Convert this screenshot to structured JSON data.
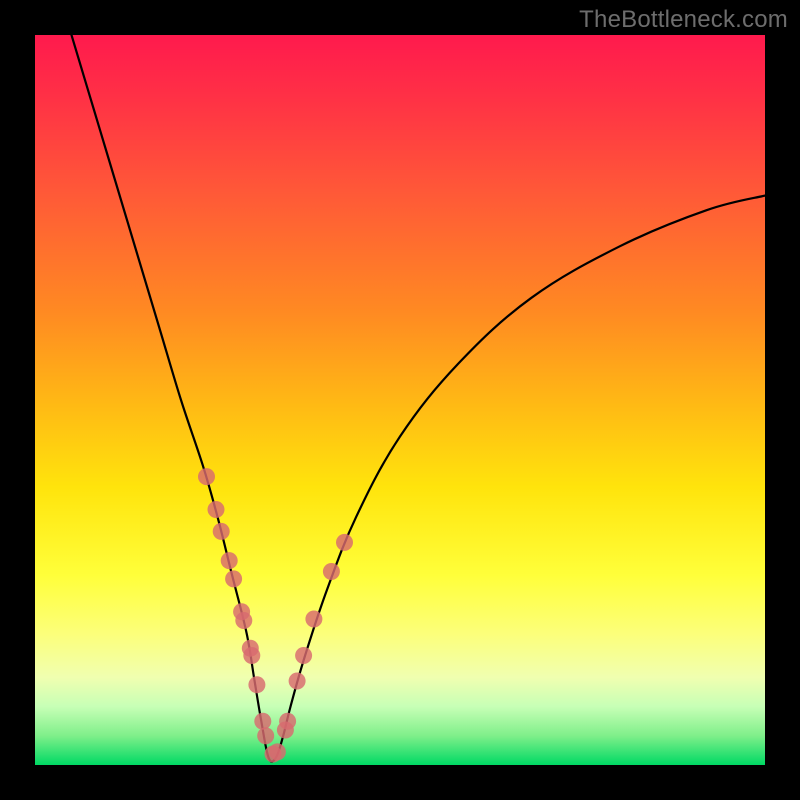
{
  "watermark": "TheBottleneck.com",
  "colors": {
    "frame": "#000000",
    "curve": "#000000",
    "dot": "#d86a6f",
    "gradient_top": "#ff1a4d",
    "gradient_bottom": "#00d964"
  },
  "chart_data": {
    "type": "line",
    "title": "",
    "xlabel": "",
    "ylabel": "",
    "xlim": [
      0,
      100
    ],
    "ylim": [
      0,
      100
    ],
    "notes": "Axes are unlabeled; percent-of-plot coordinates. y increases upward. Curve is a V-shaped bottleneck curve with minimum near x≈32, y≈0. Highlighted dots lie on the curve in the lower 30% band.",
    "series": [
      {
        "name": "bottleneck-curve",
        "x": [
          5,
          8,
          11,
          14,
          17,
          20,
          23,
          25,
          27,
          29,
          30,
          31,
          32,
          33,
          34,
          35,
          37,
          40,
          44,
          50,
          58,
          68,
          80,
          92,
          100
        ],
        "y": [
          100,
          90,
          80,
          70,
          60,
          50,
          41,
          34,
          26,
          18,
          12,
          6,
          1,
          1,
          4,
          8,
          15,
          24,
          34,
          45,
          55,
          64,
          71,
          76,
          78
        ]
      }
    ],
    "highlighted_points": {
      "name": "dots",
      "x": [
        23.5,
        24.8,
        25.5,
        26.6,
        27.2,
        28.3,
        28.6,
        29.7,
        29.5,
        30.4,
        31.2,
        31.6,
        32.6,
        33.2,
        34.3,
        34.6,
        35.9,
        36.8,
        38.2,
        40.6,
        42.4
      ],
      "y": [
        39.5,
        35.0,
        32.0,
        28.0,
        25.5,
        21.0,
        19.8,
        15.0,
        16.0,
        11.0,
        6.0,
        4.0,
        1.5,
        1.8,
        4.8,
        6.0,
        11.5,
        15.0,
        20.0,
        26.5,
        30.5
      ]
    }
  }
}
